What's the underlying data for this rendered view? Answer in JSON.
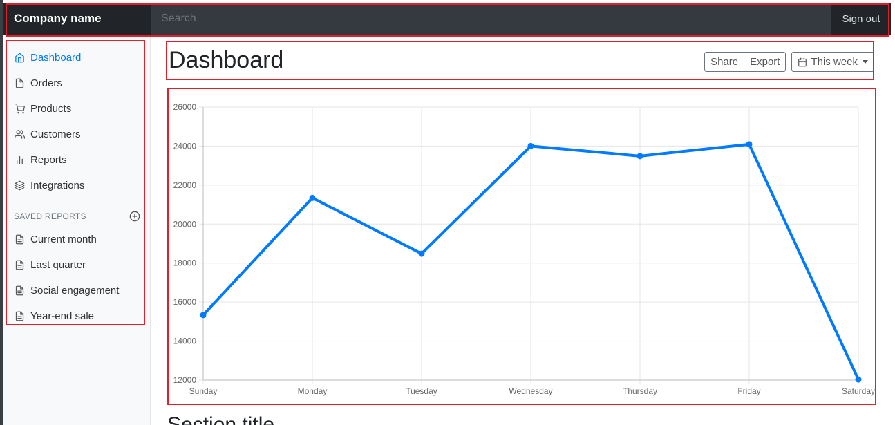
{
  "navbar": {
    "brand": "Company name",
    "search_placeholder": "Search",
    "sign_out": "Sign out"
  },
  "sidebar": {
    "items": [
      {
        "label": "Dashboard",
        "icon": "home-icon",
        "active": true
      },
      {
        "label": "Orders",
        "icon": "file-icon"
      },
      {
        "label": "Products",
        "icon": "cart-icon"
      },
      {
        "label": "Customers",
        "icon": "users-icon"
      },
      {
        "label": "Reports",
        "icon": "bar-chart-icon"
      },
      {
        "label": "Integrations",
        "icon": "layers-icon"
      }
    ],
    "saved_reports_title": "SAVED REPORTS",
    "saved_reports": [
      {
        "label": "Current month",
        "icon": "file-text-icon"
      },
      {
        "label": "Last quarter",
        "icon": "file-text-icon"
      },
      {
        "label": "Social engagement",
        "icon": "file-text-icon"
      },
      {
        "label": "Year-end sale",
        "icon": "file-text-icon"
      }
    ]
  },
  "main": {
    "title": "Dashboard",
    "share_label": "Share",
    "export_label": "Export",
    "period_label": "This week",
    "section_title": "Section title"
  },
  "colors": {
    "accent": "#007bff",
    "navbar": "#343a40",
    "brand_bg": "#212529",
    "annotation": "#e0202a"
  },
  "chart_data": {
    "type": "line",
    "categories": [
      "Sunday",
      "Monday",
      "Tuesday",
      "Wednesday",
      "Thursday",
      "Friday",
      "Saturday"
    ],
    "series": [
      {
        "values": [
          15339,
          21345,
          18483,
          24003,
          23489,
          24092,
          12034
        ]
      }
    ],
    "yticks": [
      12000,
      14000,
      16000,
      18000,
      20000,
      22000,
      24000,
      26000
    ],
    "ylim": [
      12000,
      26000
    ],
    "grid": true,
    "legend": "none"
  }
}
